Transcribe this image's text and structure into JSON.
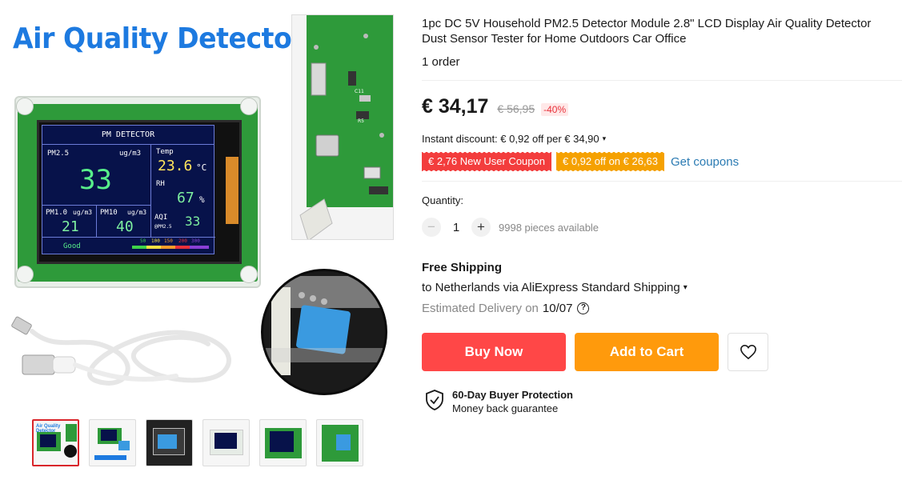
{
  "gallery": {
    "brand_title": "Air Quality Detector",
    "lcd": {
      "header": "PM DETECTOR",
      "pm25_label": "PM2.5",
      "pm25_unit": "ug/m3",
      "pm25_value": "33",
      "temp_label": "Temp",
      "temp_value": "23.6",
      "temp_unit": "°C",
      "rh_label": "RH",
      "rh_value": "67",
      "rh_unit": "%",
      "pm10_small_label": "PM1.0",
      "pm10_small_unit": "ug/m3",
      "pm10_small_value": "21",
      "pm10_label": "PM10",
      "pm10_unit": "ug/m3",
      "pm10_value": "40",
      "aqi_label": "AQI",
      "aqi_sub": "@PM2.5",
      "aqi_value": "33",
      "status": "Good",
      "scale": [
        "50",
        "100",
        "150",
        "200",
        "300"
      ],
      "scale_colors": [
        "#3fd24a",
        "#f5e142",
        "#f59b2a",
        "#e8313a",
        "#8a3fd6"
      ]
    },
    "thumbnails": [
      {
        "name": "thumb-1",
        "active": true
      },
      {
        "name": "thumb-2",
        "active": false
      },
      {
        "name": "thumb-3",
        "active": false
      },
      {
        "name": "thumb-4",
        "active": false
      },
      {
        "name": "thumb-5",
        "active": false
      },
      {
        "name": "thumb-6",
        "active": false
      }
    ]
  },
  "product": {
    "title": "1pc DC 5V Household PM2.5 Detector Module 2.8\" LCD Display Air Quality Detector Dust Sensor Tester for Home Outdoors Car Office",
    "orders": "1 order"
  },
  "pricing": {
    "price": "€ 34,17",
    "old_price": "€ 56,95",
    "discount": "-40%",
    "instant_discount": "Instant discount: € 0,92 off per € 34,90",
    "coupon_new_user": "€ 2,76 New User Coupon",
    "coupon_off": "€ 0,92 off on € 26,63",
    "get_coupons": "Get coupons"
  },
  "quantity": {
    "label": "Quantity:",
    "minus": "−",
    "value": "1",
    "plus": "+",
    "available": "9998 pieces available"
  },
  "shipping": {
    "title": "Free Shipping",
    "destination": "to Netherlands via AliExpress Standard Shipping",
    "delivery_label": "Estimated Delivery on",
    "delivery_date": "10/07",
    "help": "?"
  },
  "actions": {
    "buy_now": "Buy Now",
    "add_to_cart": "Add to Cart"
  },
  "protection": {
    "title": "60-Day Buyer Protection",
    "subtitle": "Money back guarantee"
  },
  "colors": {
    "buy": "#ff4747",
    "cart": "#ff9a0c",
    "coupon_red": "#f33d3d",
    "coupon_orange": "#f5a100",
    "link": "#2b7bb3",
    "brand_blue": "#1d7ae0"
  },
  "icons": [
    "chevron-down-icon",
    "help-icon",
    "heart-icon",
    "shield-check-icon"
  ]
}
